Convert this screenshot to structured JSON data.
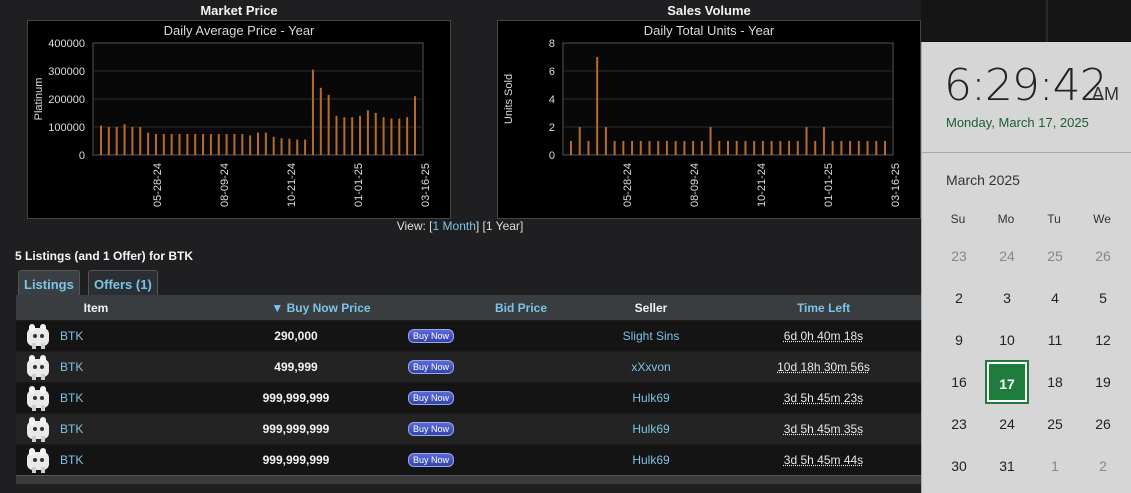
{
  "market_chart": {
    "heading": "Market Price",
    "subtitle": "Daily Average Price - Year",
    "ylabel": "Platinum",
    "yticks": [
      "400000",
      "300000",
      "200000",
      "100000",
      "0"
    ],
    "xticks": [
      "05-28-24",
      "08-09-24",
      "10-21-24",
      "01-01-25",
      "03-16-25"
    ]
  },
  "volume_chart": {
    "heading": "Sales Volume",
    "subtitle": "Daily Total Units - Year",
    "ylabel": "Units Sold",
    "yticks": [
      "8",
      "6",
      "4",
      "2",
      "0"
    ],
    "xticks": [
      "05-28-24",
      "08-09-24",
      "10-21-24",
      "01-01-25",
      "03-16-25"
    ]
  },
  "chart_data": [
    {
      "type": "bar",
      "title": "Market Price",
      "subtitle": "Daily Average Price - Year",
      "ylabel": "Platinum",
      "ylim": [
        0,
        400000
      ],
      "x_ticks": [
        "05-28-24",
        "08-09-24",
        "10-21-24",
        "01-01-25",
        "03-16-25"
      ],
      "color": "#b86a2a",
      "series": [
        {
          "values": [
            105000,
            100000,
            100000,
            110000,
            100000,
            100000,
            80000,
            75000,
            75000,
            75000,
            75000,
            75000,
            75000,
            75000,
            75000,
            75000,
            75000,
            75000,
            75000,
            70000,
            80000,
            80000,
            65000,
            60000,
            58000,
            55000,
            55000,
            305000,
            240000,
            215000,
            140000,
            135000,
            135000,
            140000,
            160000,
            150000,
            135000,
            130000,
            130000,
            135000,
            210000
          ]
        }
      ]
    },
    {
      "type": "bar",
      "title": "Sales Volume",
      "subtitle": "Daily Total Units - Year",
      "ylabel": "Units Sold",
      "ylim": [
        0,
        8
      ],
      "x_ticks": [
        "05-28-24",
        "08-09-24",
        "10-21-24",
        "01-01-25",
        "03-16-25"
      ],
      "color": "#b86a2a",
      "series": [
        {
          "values": [
            1,
            2,
            1,
            7,
            2,
            1,
            1,
            1,
            1,
            1,
            1,
            1,
            1,
            1,
            1,
            1,
            2,
            1,
            1,
            1,
            1,
            1,
            1,
            1,
            1,
            1,
            1,
            2,
            1,
            2,
            1,
            1,
            1,
            1,
            1,
            1,
            1
          ]
        }
      ]
    }
  ],
  "view": {
    "prefix": "View: [",
    "one_month": "1 Month",
    "separator": "] [",
    "one_year": "1 Year",
    "suffix": "]"
  },
  "listings_title": "5 Listings (and 1 Offer) for BTK",
  "tabs": [
    {
      "label": "Listings",
      "active": true
    },
    {
      "label": "Offers (1)",
      "active": false
    }
  ],
  "table": {
    "headers": {
      "item": "Item",
      "buy_now_price": "▼ Buy Now Price",
      "bid_price": "Bid Price",
      "seller": "Seller",
      "time_left": "Time Left"
    },
    "rows": [
      {
        "item": "BTK",
        "price": "290,000",
        "buy": "Buy Now",
        "seller": "Slight Sins",
        "time": "6d 0h 40m 18s"
      },
      {
        "item": "BTK",
        "price": "499,999",
        "buy": "Buy Now",
        "seller": "xXxvon",
        "time": "10d 18h 30m 56s"
      },
      {
        "item": "BTK",
        "price": "999,999,999",
        "buy": "Buy Now",
        "seller": "Hulk69",
        "time": "3d 5h 45m 23s"
      },
      {
        "item": "BTK",
        "price": "999,999,999",
        "buy": "Buy Now",
        "seller": "Hulk69",
        "time": "3d 5h 45m 35s"
      },
      {
        "item": "BTK",
        "price": "999,999,999",
        "buy": "Buy Now",
        "seller": "Hulk69",
        "time": "3d 5h 45m 44s"
      }
    ]
  },
  "clock": {
    "time": "6:29:42",
    "ampm": "AM",
    "date": "Monday, March 17, 2025",
    "month": "March 2025",
    "weekdays": [
      "Su",
      "Mo",
      "Tu",
      "We"
    ],
    "weeks": [
      [
        "23",
        "24",
        "25",
        "26"
      ],
      [
        "2",
        "3",
        "4",
        "5"
      ],
      [
        "9",
        "10",
        "11",
        "12"
      ],
      [
        "16",
        "17",
        "18",
        "19"
      ],
      [
        "23",
        "24",
        "25",
        "26"
      ],
      [
        "30",
        "31",
        "1",
        "2"
      ]
    ],
    "today": "17"
  }
}
